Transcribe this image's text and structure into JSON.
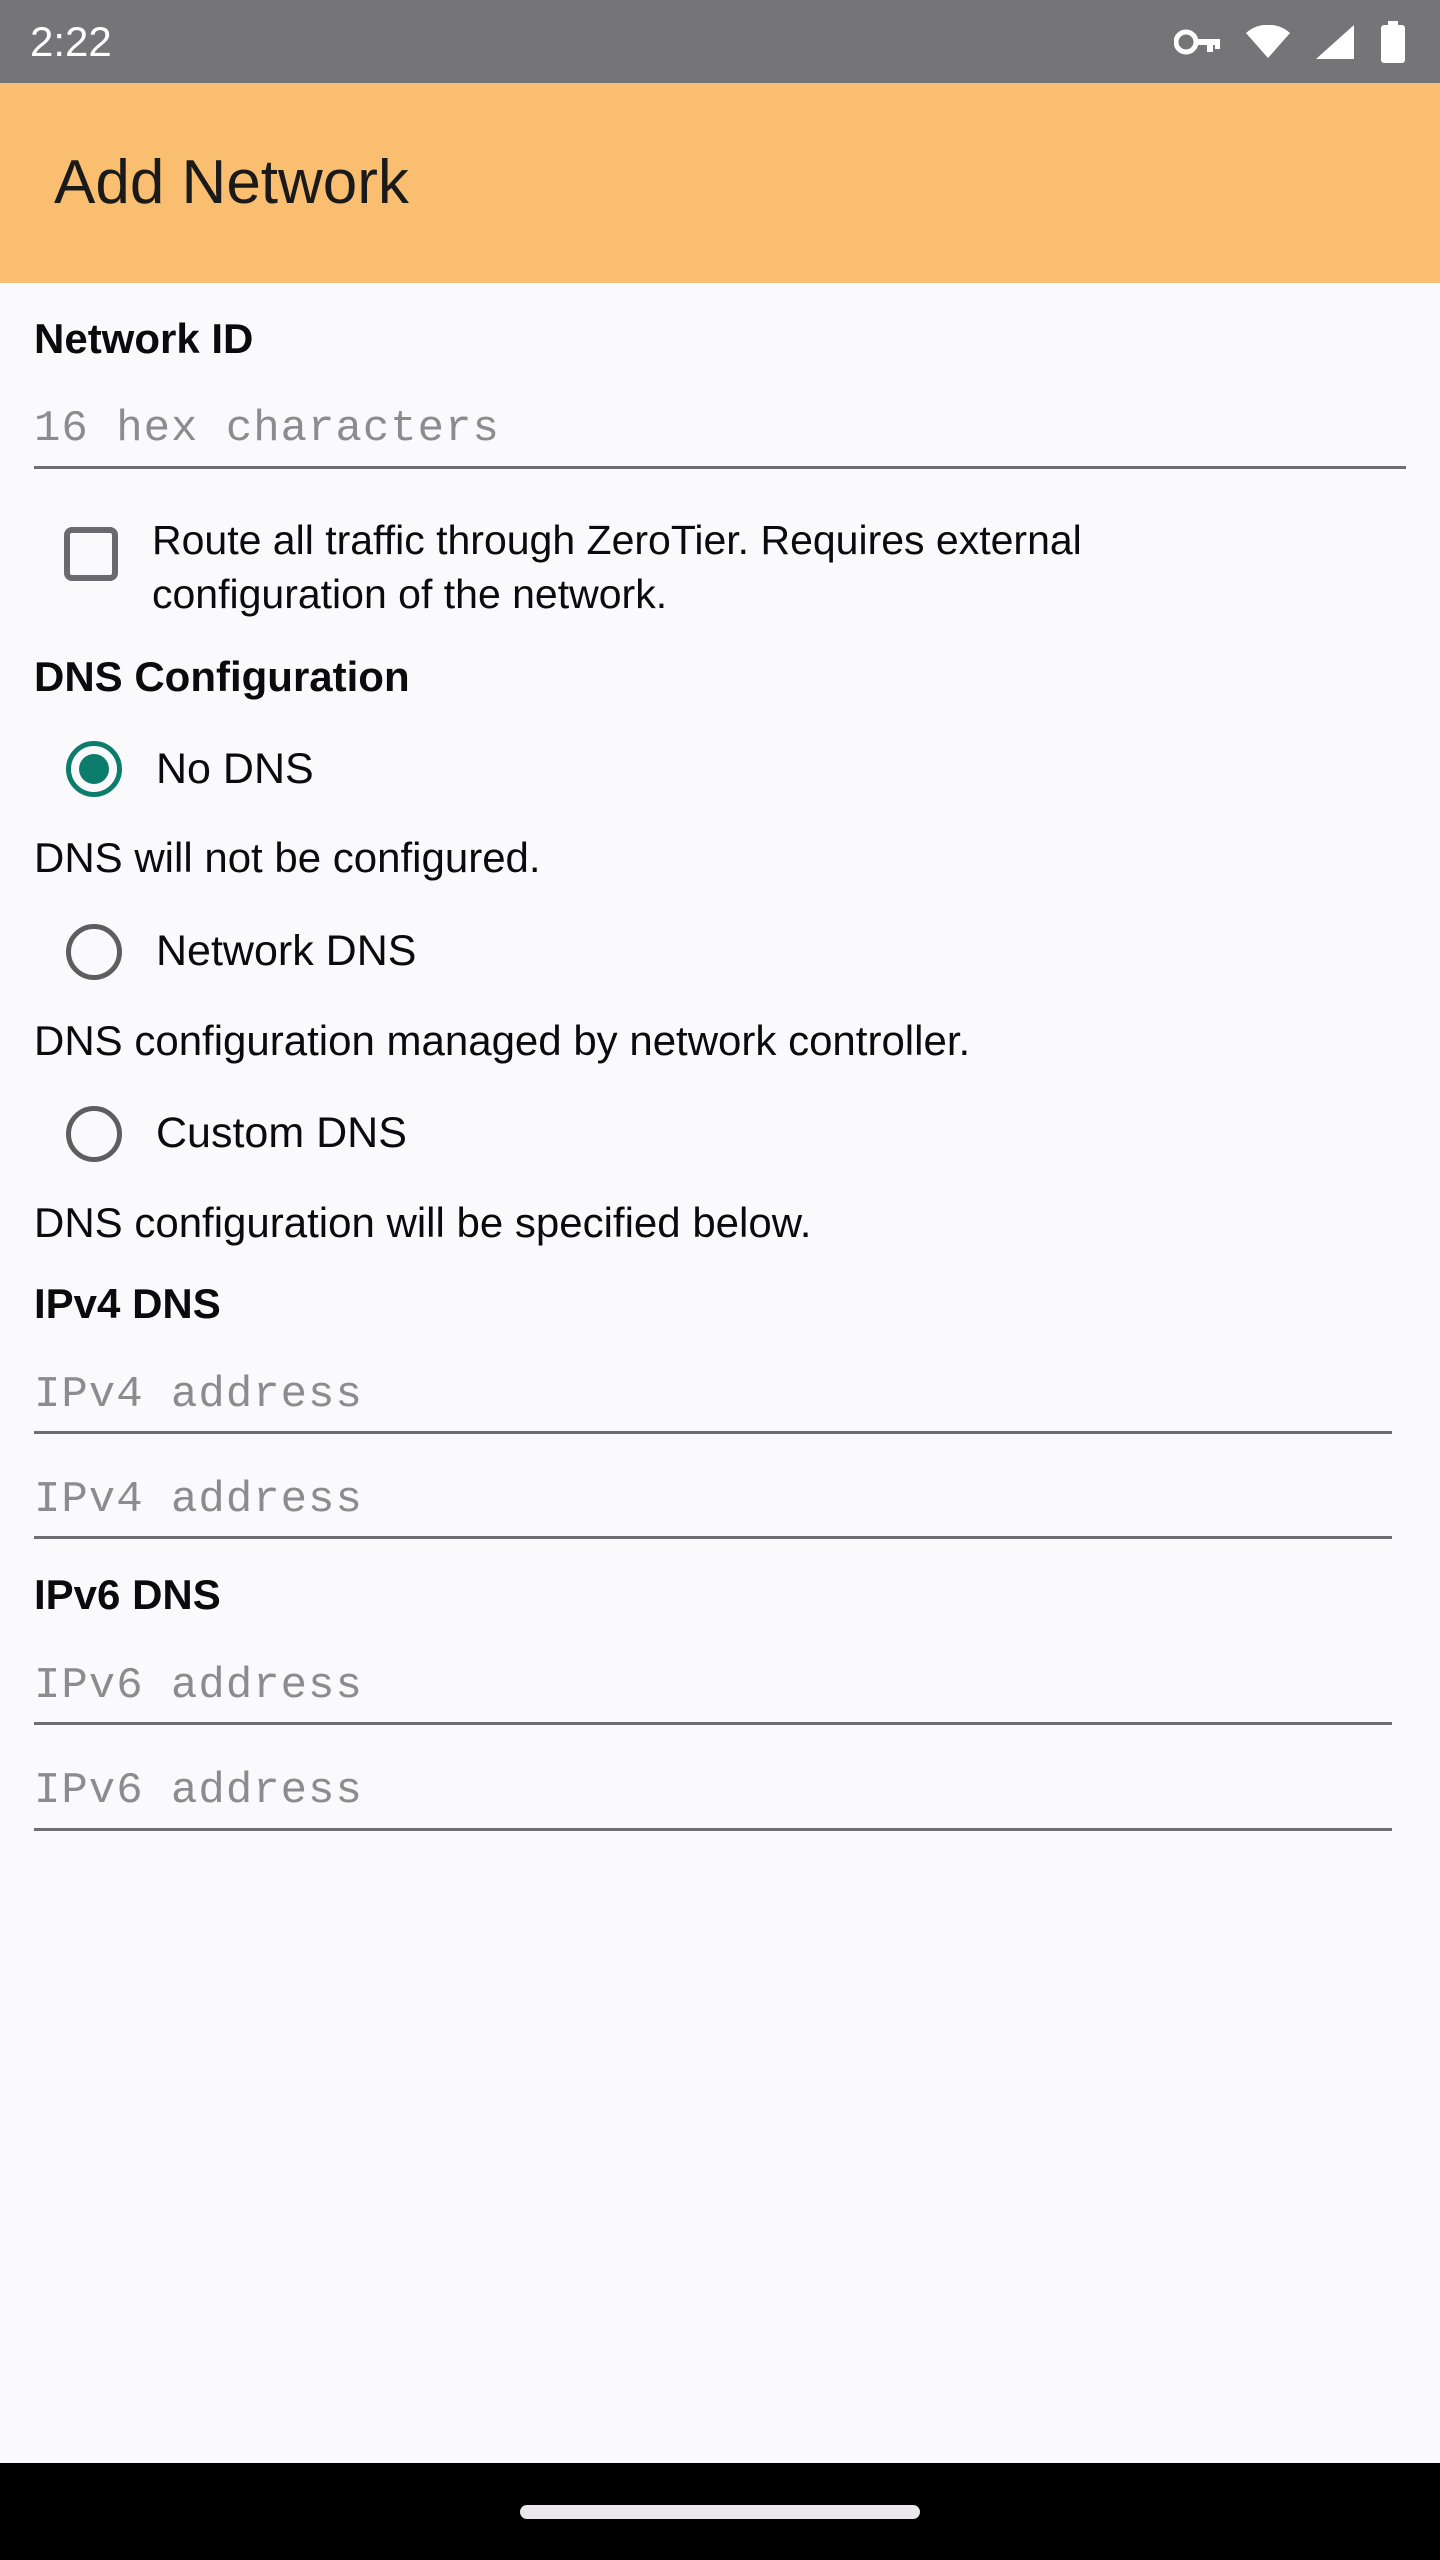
{
  "status_bar": {
    "clock": "2:22",
    "icons": [
      "vpn-key-icon",
      "wifi-icon",
      "cellular-signal-icon",
      "battery-icon"
    ],
    "background_color": "#757578",
    "foreground_color": "#FFFFFF"
  },
  "app_bar": {
    "title": "Add Network",
    "background_color": "#F9BE70",
    "title_color": "#1A1A1A"
  },
  "content": {
    "background_color": "#FAFAFC",
    "network_id": {
      "heading": "Network ID",
      "input_placeholder": "16 hex characters",
      "input_value": ""
    },
    "route_all_traffic": {
      "label": "Route all traffic through ZeroTier. Requires external configuration of the network.",
      "checked": false
    },
    "dns_configuration": {
      "heading": "DNS Configuration",
      "accent_color": "#0C7D6C",
      "selected": "No DNS",
      "options": [
        {
          "label": "No DNS",
          "description": "DNS will not be configured.",
          "selected": true
        },
        {
          "label": "Network DNS",
          "description": "DNS configuration managed by network controller.",
          "selected": false
        },
        {
          "label": "Custom DNS",
          "description": "DNS configuration will be specified below.",
          "selected": false
        }
      ]
    },
    "ipv4_dns": {
      "heading": "IPv4 DNS",
      "fields": [
        {
          "placeholder": "IPv4 address",
          "value": ""
        },
        {
          "placeholder": "IPv4 address",
          "value": ""
        }
      ]
    },
    "ipv6_dns": {
      "heading": "IPv6 DNS",
      "fields": [
        {
          "placeholder": "IPv6 address",
          "value": ""
        },
        {
          "placeholder": "IPv6 address",
          "value": ""
        }
      ]
    }
  },
  "nav_bar": {
    "background_color": "#000000",
    "gesture_pill_color": "#EAE8EA"
  }
}
